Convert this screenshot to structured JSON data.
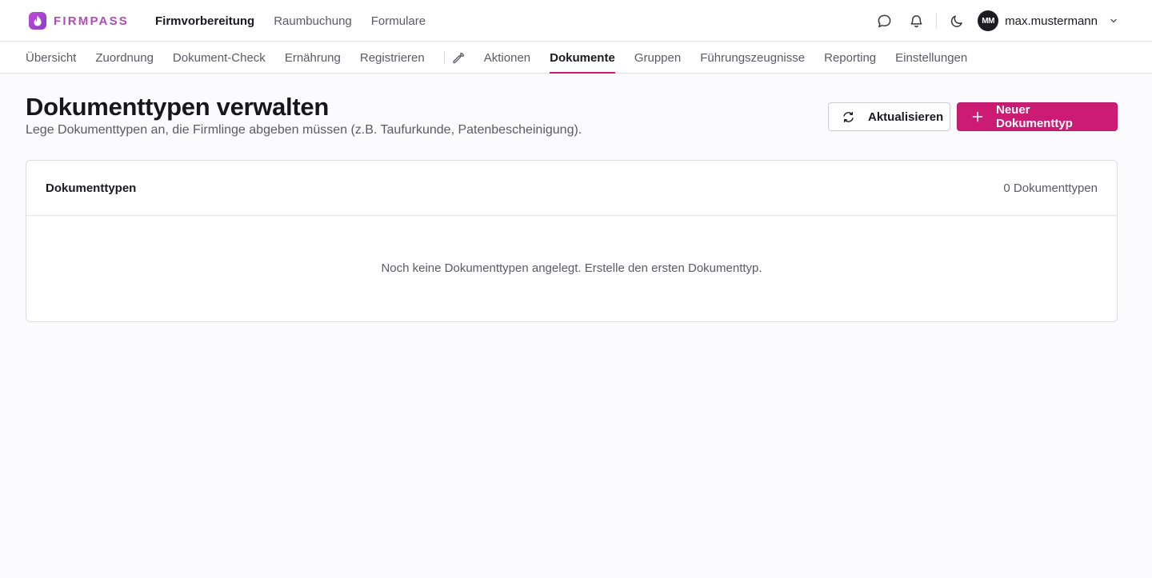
{
  "brand": {
    "name": "FIRMPASS"
  },
  "main_nav": [
    {
      "label": "Firmvorbereitung",
      "active": true
    },
    {
      "label": "Raumbuchung",
      "active": false
    },
    {
      "label": "Formulare",
      "active": false
    }
  ],
  "user": {
    "initials": "MM",
    "name": "max.mustermann"
  },
  "sub_nav": {
    "left": [
      "Übersicht",
      "Zuordnung",
      "Dokument-Check",
      "Ernährung",
      "Registrieren"
    ],
    "right": [
      "Aktionen",
      "Dokumente",
      "Gruppen",
      "Führungszeugnisse",
      "Reporting",
      "Einstellungen"
    ],
    "active": "Dokumente"
  },
  "page": {
    "title": "Dokumenttypen verwalten",
    "subtitle": "Lege Dokumenttypen an, die Firmlinge abgeben müssen (z.B. Taufurkunde, Patenbescheinigung)."
  },
  "actions": {
    "refresh_label": "Aktualisieren",
    "new_label": "Neuer Dokumenttyp"
  },
  "card": {
    "title": "Dokumenttypen",
    "count": "0 Dokumenttypen",
    "empty": "Noch keine Dokumenttypen angelegt. Erstelle den ersten Dokumenttyp."
  },
  "colors": {
    "accent": "#cc1b73",
    "brand": "#b14bb5",
    "background": "#fbfafd"
  },
  "icons": [
    "flame-icon",
    "chat-icon",
    "bell-icon",
    "moon-icon",
    "chevron-down-icon",
    "wrench-icon",
    "refresh-icon",
    "plus-icon"
  ]
}
